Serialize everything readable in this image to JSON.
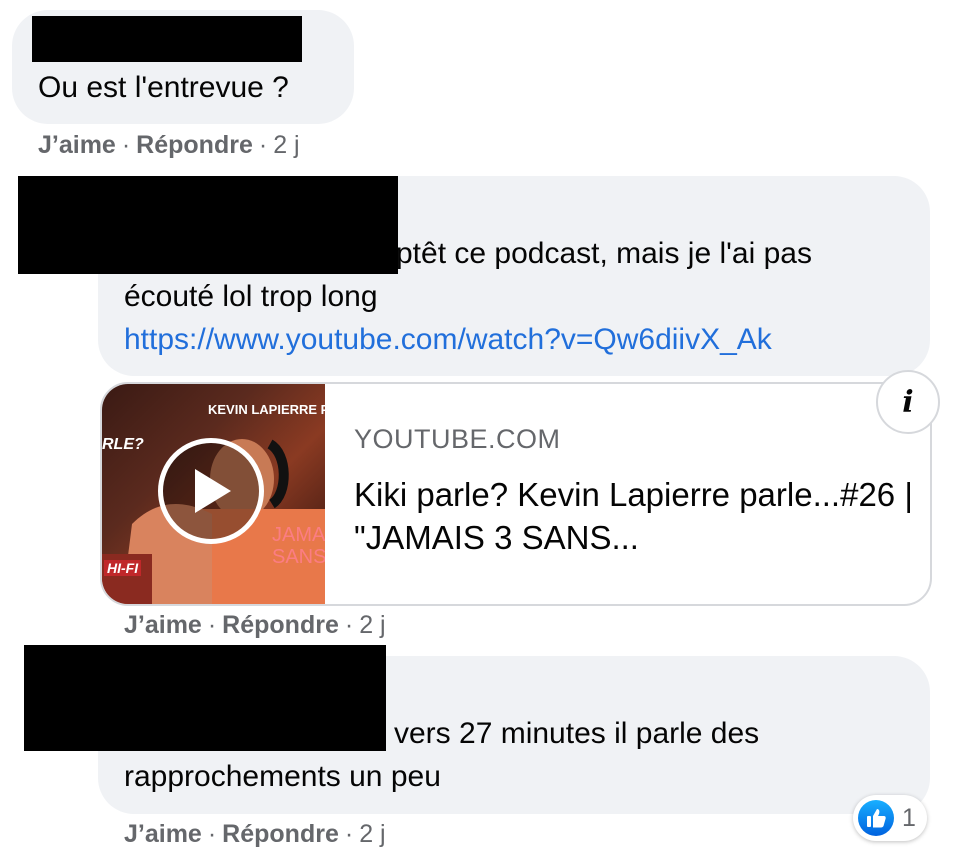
{
  "comments": [
    {
      "author_redacted": true,
      "text_lines": [
        "Ou est l'entrevue ?"
      ],
      "actions": {
        "like": "J’aime",
        "reply": "Répondre",
        "time": "2 j"
      }
    },
    {
      "author_redacted": true,
      "text_lines": [
        "ptêt ce podcast, mais je l'ai pas",
        "écouté lol trop long"
      ],
      "link": "https://www.youtube.com/watch?v=Qw6diivX_Ak",
      "preview": {
        "domain": "YOUTUBE.COM",
        "title": "Kiki parle? Kevin Lapierre parle...#26 | \"JAMAIS 3 SANS...",
        "thumb_text_top": "KEVIN LAPIERRE P",
        "thumb_text_left": "RLE?",
        "thumb_text_overlay": "JAMAIS SANS",
        "thumb_badge": "HI-FI",
        "play_icon": "play-icon",
        "info_icon": "info-icon",
        "info_glyph": "i"
      },
      "actions": {
        "like": "J’aime",
        "reply": "Répondre",
        "time": "2 j"
      }
    },
    {
      "author_redacted": true,
      "text_lines": [
        "vers 27 minutes il parle des",
        "rapprochements un peu"
      ],
      "reactions": {
        "icon": "thumbs-up-icon",
        "count": "1"
      },
      "actions": {
        "like": "J’aime",
        "reply": "Répondre",
        "time": "2 j"
      }
    }
  ],
  "colors": {
    "bubble": "#f0f2f5",
    "link": "#216fdb",
    "meta": "#65676b",
    "like_blue": "#0062df"
  }
}
